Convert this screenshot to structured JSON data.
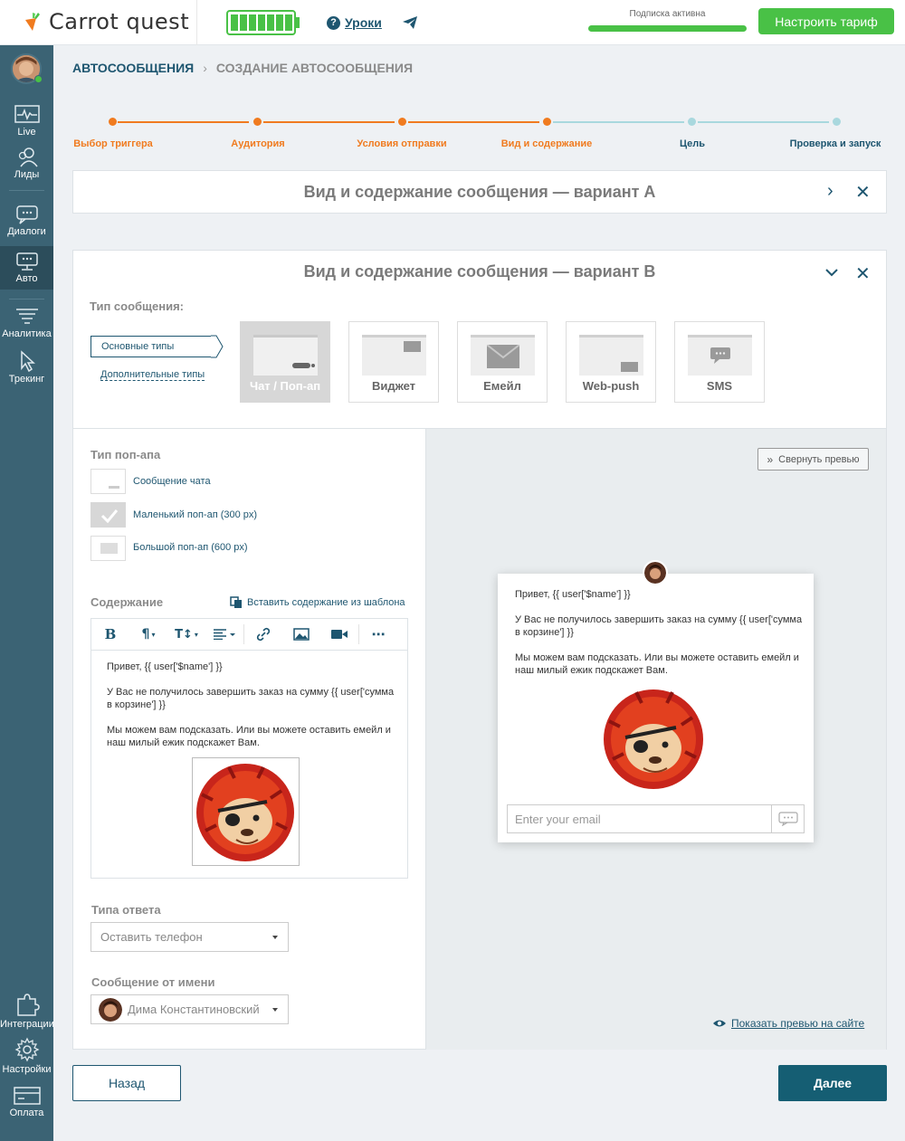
{
  "brand": {
    "name": "Carrot quest",
    "accent": "#f07b1f",
    "primary": "#1e5670",
    "green": "#49c146"
  },
  "topbar": {
    "lessons_label": "Уроки",
    "help_icon": "question-circle-icon",
    "telegram_icon": "telegram-icon",
    "subscription_label": "Подписка активна",
    "tariff_button": "Настроить тариф"
  },
  "sidebar": {
    "items": [
      {
        "label": "Live",
        "icon": "pulse-icon"
      },
      {
        "label": "Лиды",
        "icon": "users-icon"
      },
      {
        "label": "Диалоги",
        "icon": "chat-icon"
      },
      {
        "label": "Авто",
        "icon": "auto-message-icon",
        "active": true
      },
      {
        "label": "Аналитика",
        "icon": "analytics-icon"
      },
      {
        "label": "Трекинг",
        "icon": "cursor-icon"
      },
      {
        "label": "Интеграции",
        "icon": "puzzle-icon"
      },
      {
        "label": "Настройки",
        "icon": "gear-icon"
      },
      {
        "label": "Оплата",
        "icon": "card-icon"
      }
    ]
  },
  "breadcrumbs": {
    "root": "АВТОСООБЩЕНИЯ",
    "current": "СОЗДАНИЕ АВТОСООБЩЕНИЯ"
  },
  "stepper": {
    "steps": [
      {
        "label": "Выбор триггера",
        "done": true
      },
      {
        "label": "Аудитория",
        "done": true
      },
      {
        "label": "Условия отправки",
        "done": true
      },
      {
        "label": "Вид и содержание",
        "done": true
      },
      {
        "label": "Цель",
        "done": false
      },
      {
        "label": "Проверка и запуск",
        "done": false
      }
    ]
  },
  "variant_a": {
    "title": "Вид и содержание сообщения — вариант А"
  },
  "variant_b": {
    "title": "Вид и содержание сообщения — вариант В",
    "type_label": "Тип сообщения:",
    "basic_types": "Основные типы",
    "extra_types": "Дополнительные типы",
    "message_types": [
      {
        "label": "Чат / Поп-ап",
        "selected": true
      },
      {
        "label": "Виджет",
        "selected": false
      },
      {
        "label": "Емейл",
        "selected": false
      },
      {
        "label": "Web-push",
        "selected": false
      },
      {
        "label": "SMS",
        "selected": false
      }
    ],
    "popup_type_label": "Тип поп-апа",
    "popup_types": [
      {
        "label": "Сообщение чата",
        "checked": false
      },
      {
        "label": "Маленький поп-ап (300 px)",
        "checked": true
      },
      {
        "label": "Большой поп-ап (600 px)",
        "checked": false
      }
    ],
    "content_label": "Содержание",
    "insert_template": "Вставить содержание из шаблона",
    "content": {
      "greeting": "Привет, {{ user['$name'] }}",
      "line2": "У Вас не получилось завершить заказ на сумму {{ user['сумма в корзине'] }}",
      "line3": "Мы можем вам подсказать. Или вы можете оставить емейл и наш милый ежик подскажет Вам."
    },
    "reply_type_label": "Типа ответа",
    "reply_type_value": "Оставить телефон",
    "sender_label": "Сообщение от имени",
    "sender_value": "Дима Константиновский",
    "collapse_preview": "Свернуть превью",
    "email_placeholder": "Enter your email",
    "show_preview": "Показать превью на сайте"
  },
  "footer": {
    "back": "Назад",
    "next": "Далее"
  }
}
